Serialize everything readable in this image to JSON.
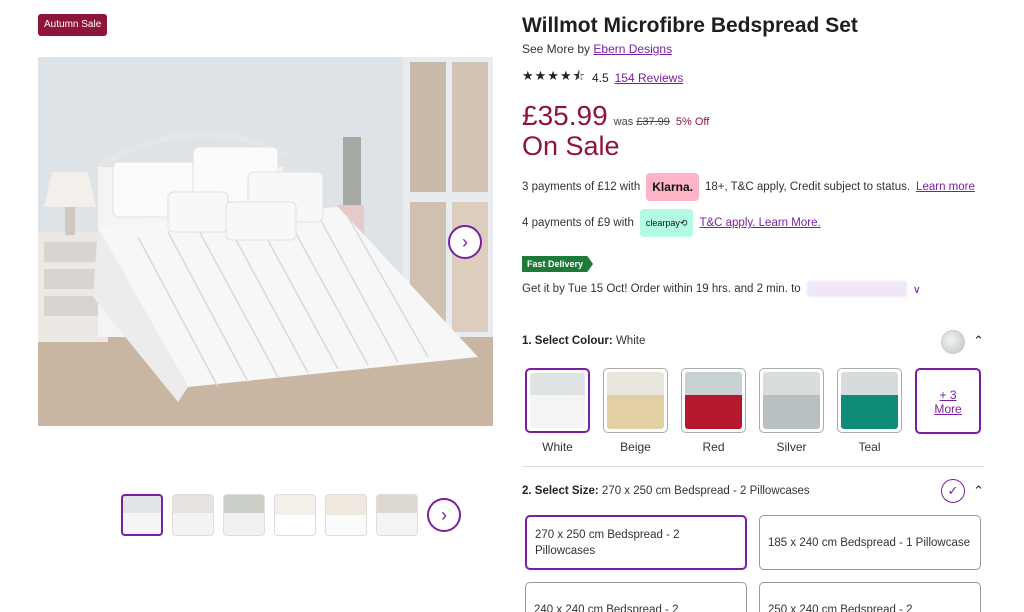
{
  "badge": "Autumn Sale",
  "product": {
    "title": "Willmot Microfibre Bedspread Set",
    "see_more_prefix": "See More by",
    "brand": "Ebern Designs",
    "rating": "4.5",
    "reviews": "154 Reviews",
    "stars": "★★★★⯪"
  },
  "pricing": {
    "price": "£35.99",
    "was_label": "was",
    "was_price": "£37.99",
    "off": "5% Off",
    "on_sale": "On Sale"
  },
  "klarna": {
    "text": "3 payments of £12 with",
    "logo": "Klarna.",
    "terms": "18+, T&C apply, Credit subject to status.",
    "link": "Learn more"
  },
  "clearpay": {
    "text": "4 payments of £9 with",
    "logo": "clearpay⟲",
    "link": "T&C apply. Learn More."
  },
  "delivery": {
    "badge": "Fast Delivery",
    "text": "Get it by Tue 15 Oct! Order within 19 hrs. and 2 min. to"
  },
  "colour_section": {
    "heading": "1. Select Colour:",
    "selected": "White",
    "options": [
      {
        "label": "White",
        "color": "#f1f1f1"
      },
      {
        "label": "Beige",
        "color": "#e2cfa4"
      },
      {
        "label": "Red",
        "color": "#b3182c"
      },
      {
        "label": "Silver",
        "color": "#b9c0c3"
      },
      {
        "label": "Teal",
        "color": "#0e8c78"
      }
    ],
    "more_count": "+ 3",
    "more_label": "More"
  },
  "size_section": {
    "heading": "2. Select Size:",
    "selected": "270 x 250 cm Bedspread - 2 Pillowcases",
    "options": [
      "270 x 250 cm Bedspread - 2 Pillowcases",
      "185 x 240 cm Bedspread - 1 Pillowcase",
      "240 x 240 cm Bedspread - 2",
      "250 x 240 cm Bedspread - 2"
    ]
  },
  "icons": {
    "hero_next": "chevron-right-icon",
    "collapse": "chevron-up-icon",
    "check": "check-icon"
  },
  "colors": {
    "accent": "#7b1fa2",
    "sale": "#8e1538",
    "fast_delivery": "#1d7a3a"
  }
}
